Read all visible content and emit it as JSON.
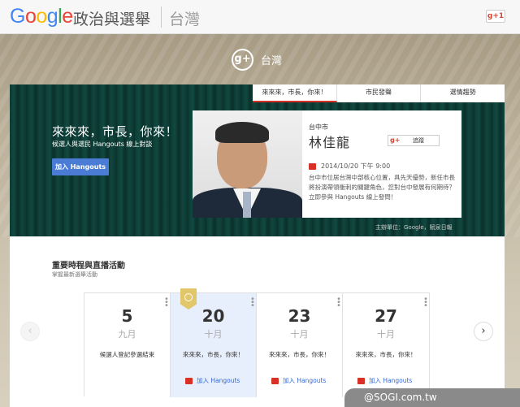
{
  "header": {
    "logo_letters": [
      "G",
      "o",
      "o",
      "g",
      "l",
      "e"
    ],
    "logo_colors": [
      "#4285f4",
      "#ea4335",
      "#fbbc05",
      "#4285f4",
      "#34a853",
      "#ea4335"
    ],
    "site_title": "政治與選舉",
    "region": "台灣",
    "gplus_one": "g+1"
  },
  "banner": {
    "gplus_icon": "g+",
    "label": "台灣"
  },
  "tabs": [
    {
      "label": "來來來，市長，你來！",
      "active": true
    },
    {
      "label": "市民發聲",
      "active": false
    },
    {
      "label": "選情趨勢",
      "active": false
    }
  ],
  "hero": {
    "title": "來來來，市長，你來！",
    "subtitle": "候選人與選民 Hangouts 線上對談",
    "button": "加入 Hangouts"
  },
  "card": {
    "city": "台中市",
    "name": "林佳龍",
    "follow_icon": "g+",
    "follow_label": "追蹤",
    "datetime": "2014/10/20 下午 9:00",
    "description": "台中市位居台灣中部核心位置，具先天優勢，新任市長將扮演帶領衝刺的關鍵角色，您對台中發展有何期待？立即參與 Hangouts 線上發問！"
  },
  "sponsor": "主辦單位：Google，賦泉日報",
  "section": {
    "title": "重要時程與直播活動",
    "subtitle": "掌握最新選舉活動"
  },
  "events": [
    {
      "day": "5",
      "month": "九月",
      "title": "候選人登記參選結束",
      "join": "",
      "active": false
    },
    {
      "day": "20",
      "month": "十月",
      "title": "來來來，市長，你來！",
      "join": "加入 Hangouts",
      "active": true
    },
    {
      "day": "23",
      "month": "十月",
      "title": "來來來，市長，你來！",
      "join": "加入 Hangouts",
      "active": false
    },
    {
      "day": "27",
      "month": "十月",
      "title": "來來來，市長，你來！",
      "join": "加入 Hangouts",
      "active": false
    }
  ],
  "nav": {
    "prev_icon": "‹",
    "next_icon": "›"
  },
  "watermark": "@SOGI.com.tw"
}
